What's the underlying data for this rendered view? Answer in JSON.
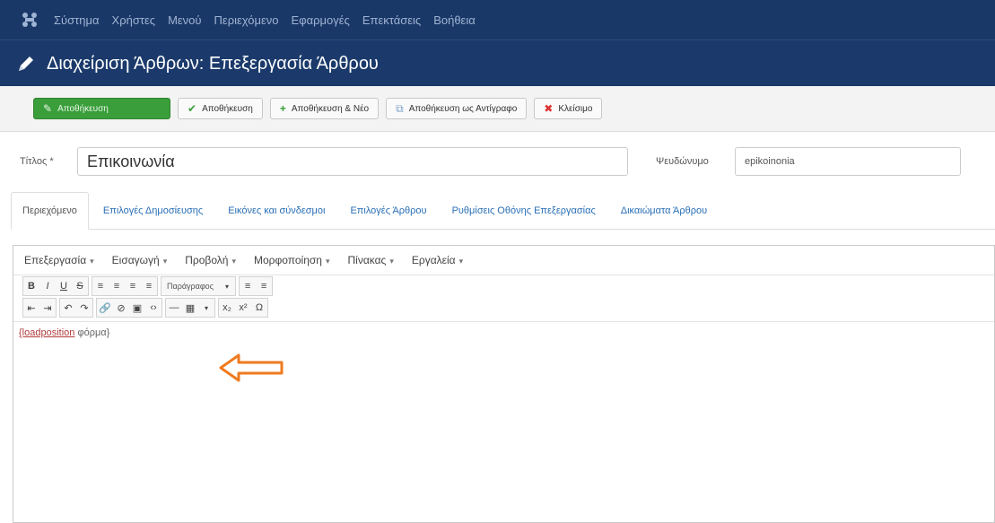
{
  "topbar": {
    "logo_icon": "joomla-icon",
    "menu": [
      "Σύστημα",
      "Χρήστες",
      "Μενού",
      "Περιεχόμενο",
      "Εφαρμογές",
      "Επεκτάσεις",
      "Βοήθεια"
    ]
  },
  "header": {
    "icon": "pencil-icon",
    "title": "Διαχείριση Άρθρων: Επεξεργασία Άρθρου"
  },
  "toolbar": {
    "save_apply": "Αποθήκευση",
    "save_close": "Αποθήκευση",
    "save_new": "Αποθήκευση & Νέο",
    "save_copy": "Αποθήκευση ως Αντίγραφο",
    "close": "Κλείσιμο"
  },
  "form": {
    "title_label": "Τίτλος *",
    "title_value": "Επικοινωνία",
    "alias_label": "Ψευδώνυμο",
    "alias_value": "epikoinonia"
  },
  "tabs": [
    "Περιεχόμενο",
    "Επιλογές Δημοσίευσης",
    "Εικόνες και σύνδεσμοι",
    "Επιλογές Άρθρου",
    "Ρυθμίσεις Οθόνης Επεξεργασίας",
    "Δικαιώματα Άρθρου"
  ],
  "editor": {
    "menu": [
      "Επεξεργασία",
      "Εισαγωγή",
      "Προβολή",
      "Μορφοποίηση",
      "Πίνακας",
      "Εργαλεία"
    ],
    "format_select": "Παράγραφος",
    "content_keyword": "{loadposition",
    "content_rest": " φόρμα}"
  },
  "colors": {
    "topbar": "#1a3867",
    "header": "#1b3a6b",
    "primary_button": "#3a9e3a",
    "arrow": "#f07a1e",
    "link": "#2a6fb5"
  }
}
